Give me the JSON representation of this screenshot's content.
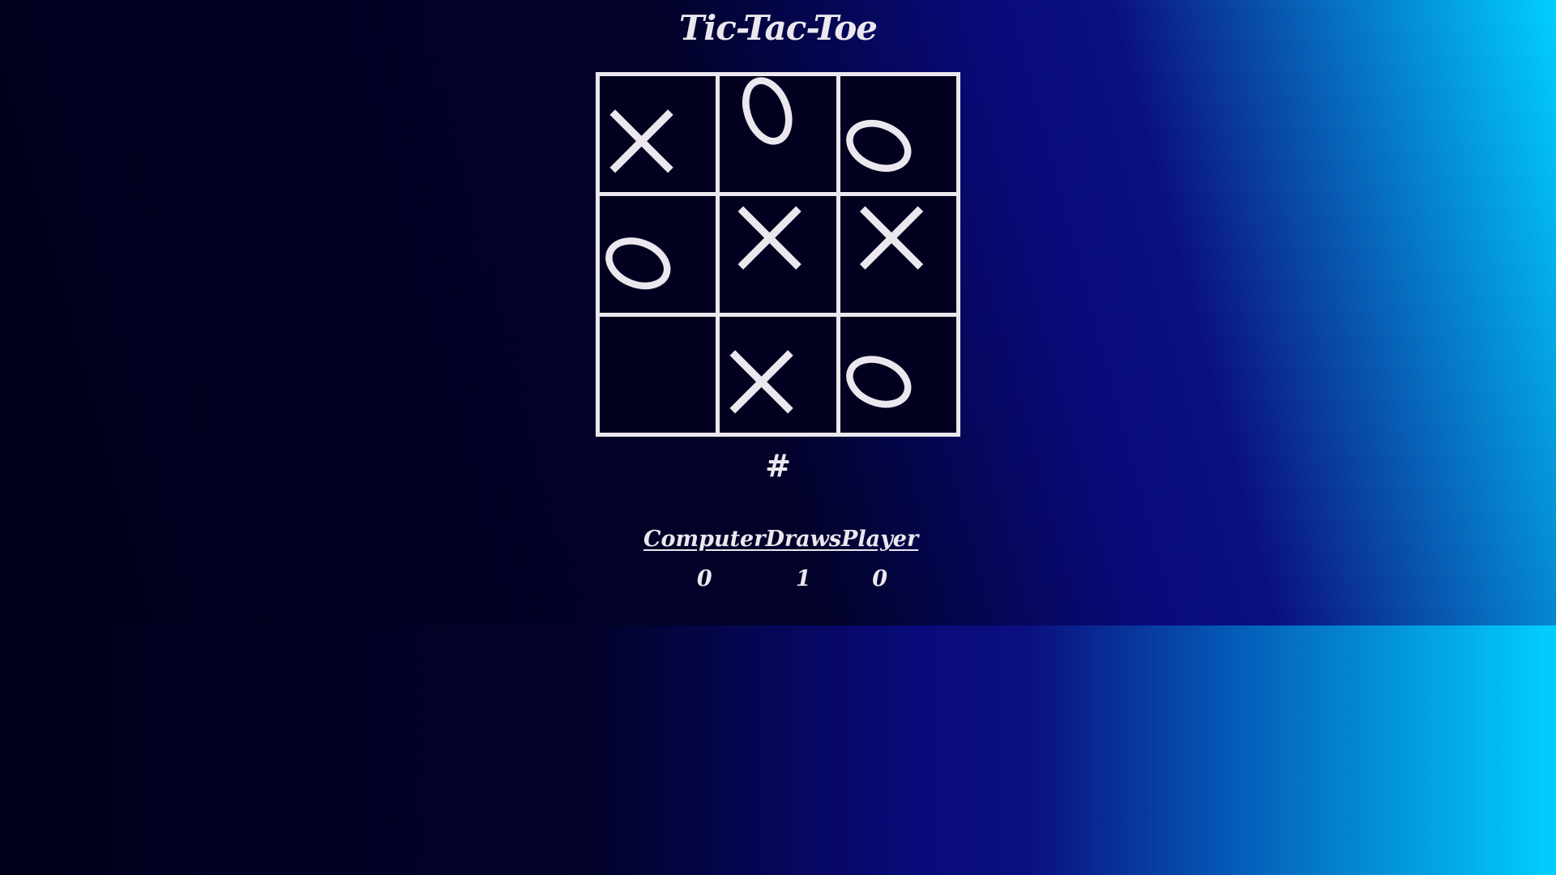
{
  "title": "Tic-Tac-Toe",
  "board": {
    "cells": [
      "X",
      "O",
      "O",
      "O",
      "X",
      "X",
      "",
      "X",
      "O"
    ]
  },
  "status": "#",
  "scoreboard": {
    "columns": [
      {
        "label": "Computer",
        "value": "0"
      },
      {
        "label": "Draws",
        "value": "1"
      },
      {
        "label": "Player",
        "value": "0"
      }
    ]
  },
  "colors": {
    "mark": "#ebe7ee",
    "cell_background": "#02011f",
    "accent": "#01cfff"
  }
}
